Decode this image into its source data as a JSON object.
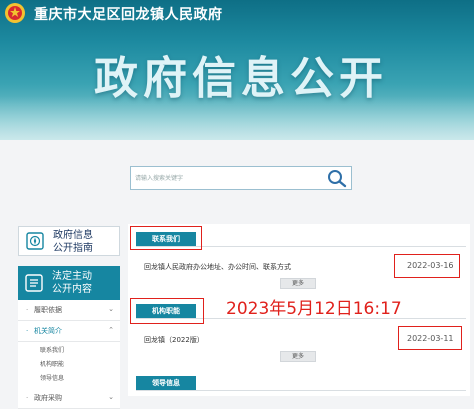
{
  "header": {
    "site_title": "重庆市大足区回龙镇人民政府",
    "big_title": "政府信息公开"
  },
  "search": {
    "placeholder": "请输入搜索关键字",
    "icon": "search-icon"
  },
  "sidebar": {
    "guide": {
      "line1": "政府信息",
      "line2": "公开指南",
      "icon": "compass-icon"
    },
    "active": {
      "line1": "法定主动",
      "line2": "公开内容",
      "icon": "list-icon"
    },
    "menu": [
      {
        "label": "履职依据",
        "expanded": false
      },
      {
        "label": "机关简介",
        "expanded": true,
        "children": [
          "联系我们",
          "机构职能",
          "领导信息"
        ]
      },
      {
        "label": "政府采购",
        "expanded": false
      }
    ]
  },
  "main": {
    "sections": [
      {
        "title": "联系我们",
        "entry": "回龙镇人民政府办公地址、办公时间、联系方式",
        "date": "2022-03-16",
        "more": "更多"
      },
      {
        "title": "机构职能",
        "entry": "回龙镇（2022版）",
        "date": "2022-03-11",
        "more": "更多"
      },
      {
        "title": "领导信息"
      }
    ]
  },
  "annotation": {
    "timestamp": "2023年5月12日16:17"
  },
  "colors": {
    "accent": "#1686a1",
    "annotation_red": "#e0211c",
    "header_dark": "#0e6f86"
  }
}
